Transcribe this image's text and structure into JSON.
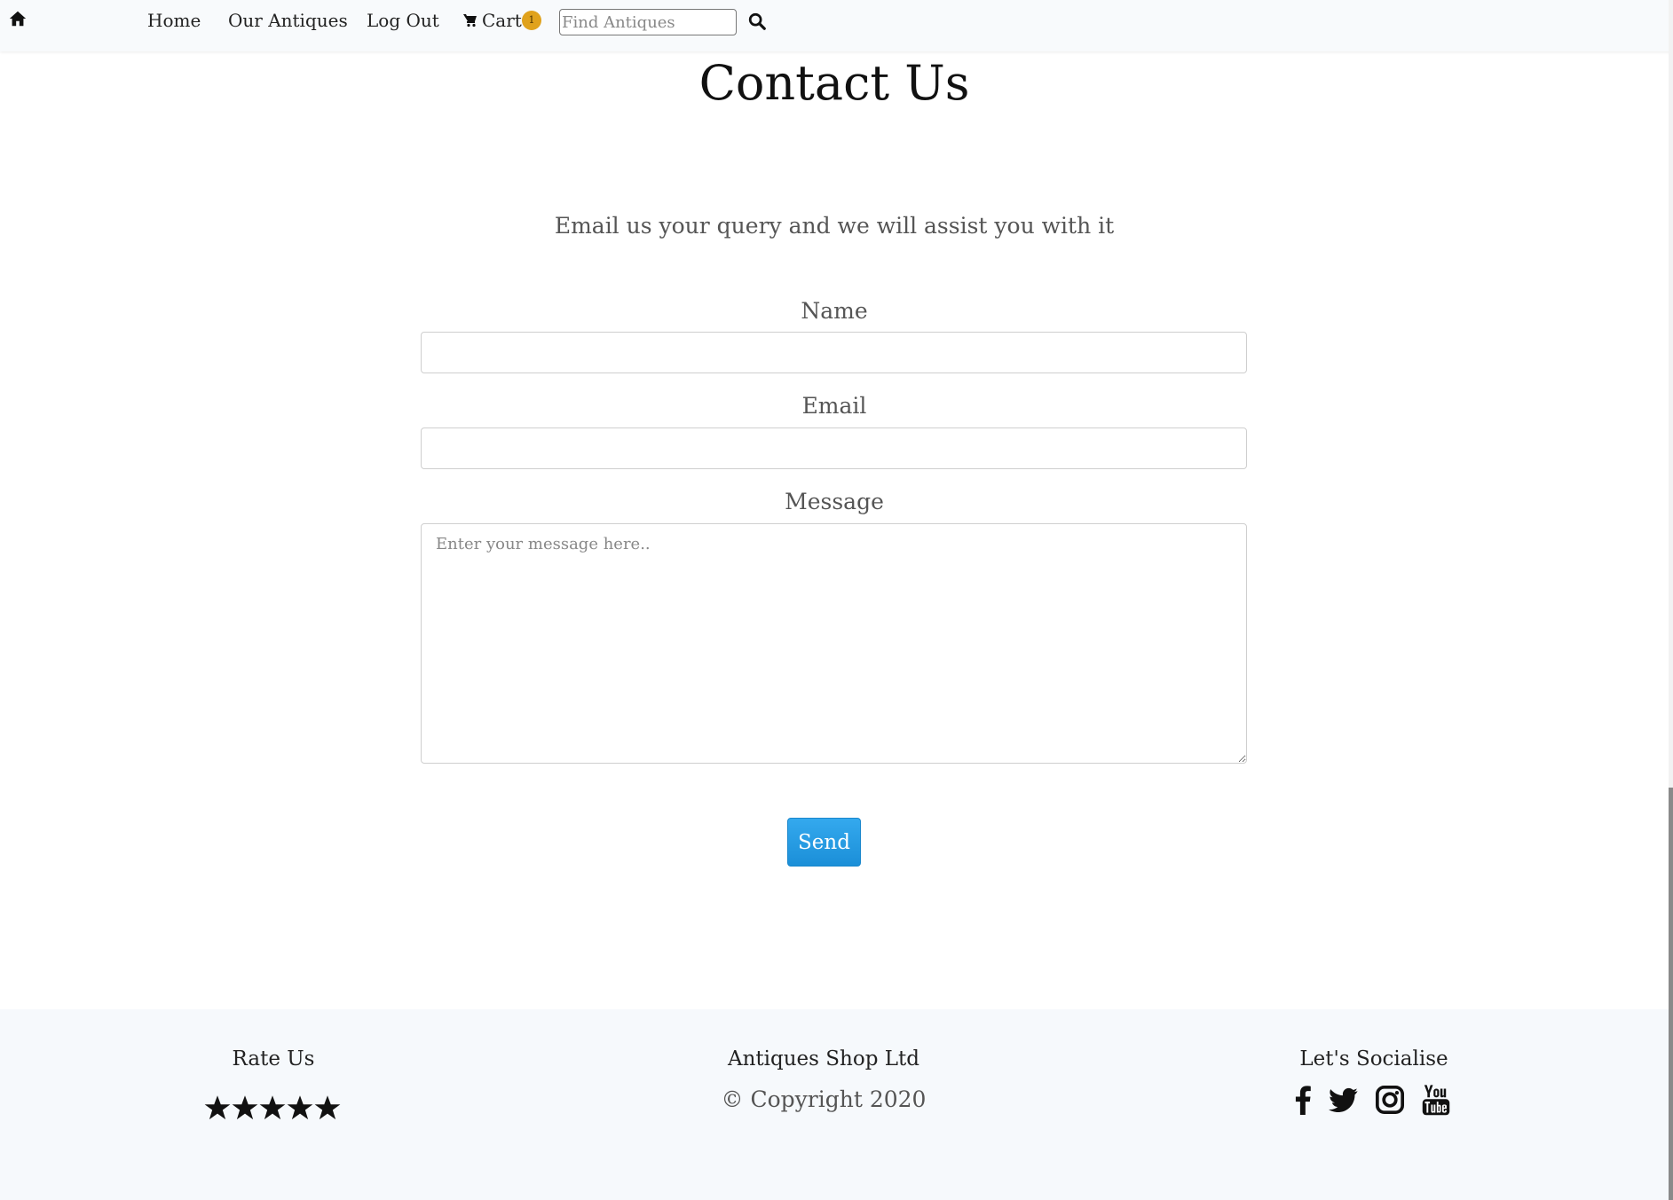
{
  "navbar": {
    "home_icon": "home-icon",
    "links": [
      "Home",
      "Our Antiques",
      "Log Out"
    ],
    "cart_label": "Cart",
    "cart_icon": "cart-icon",
    "cart_count": "1",
    "search_placeholder": "Find Antiques",
    "search_icon": "search-icon"
  },
  "main": {
    "title": "Contact Us",
    "intro": "Email us your query and we will assist you with it",
    "form": {
      "name_label": "Name",
      "name_value": "",
      "email_label": "Email",
      "email_value": "",
      "message_label": "Message",
      "message_placeholder": "Enter your message here..",
      "send_label": "Send"
    }
  },
  "footer": {
    "rate_heading": "Rate Us",
    "rating": 5,
    "rating_max": 5,
    "company": "Antiques Shop Ltd",
    "copyright": "© Copyright 2020",
    "social_heading": "Let's Socialise",
    "social_icons": [
      "facebook-icon",
      "twitter-icon",
      "instagram-icon",
      "youtube-icon"
    ]
  },
  "colors": {
    "navbar_bg": "#f8fafc",
    "badge": "#e0a21c",
    "button": "#1b8fd8",
    "footer_bg": "#f6f9fc"
  }
}
